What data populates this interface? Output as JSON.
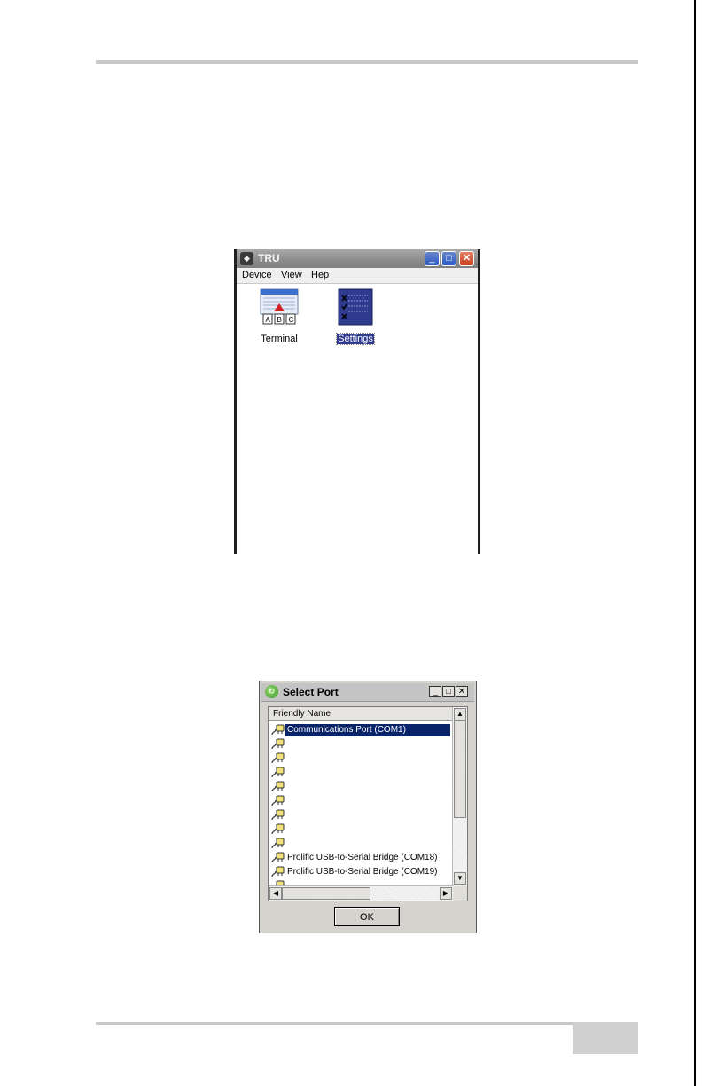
{
  "tru_window": {
    "title": "TRU",
    "menu": [
      "Device",
      "View",
      "Hep"
    ],
    "icons": [
      {
        "label": "Terminal",
        "icon": "terminal-icon",
        "selected": false
      },
      {
        "label": "Settings",
        "icon": "settings-icon",
        "selected": true
      }
    ],
    "controls": {
      "minimize": "_",
      "maximize": "□",
      "close": "✕"
    }
  },
  "select_port": {
    "title": "Select Port",
    "column_header": "Friendly Name",
    "ports": [
      {
        "label": "Communications Port (COM1)",
        "selected": true
      },
      {
        "label": "",
        "selected": false
      },
      {
        "label": "",
        "selected": false
      },
      {
        "label": "",
        "selected": false
      },
      {
        "label": "",
        "selected": false
      },
      {
        "label": "",
        "selected": false
      },
      {
        "label": "",
        "selected": false
      },
      {
        "label": "",
        "selected": false
      },
      {
        "label": "",
        "selected": false
      },
      {
        "label": "Prolific USB-to-Serial Bridge (COM18)",
        "selected": false
      },
      {
        "label": "Prolific USB-to-Serial Bridge (COM19)",
        "selected": false
      },
      {
        "label": "",
        "selected": false
      }
    ],
    "ok_label": "OK",
    "controls": {
      "minimize": "_",
      "maximize": "□",
      "close": "✕"
    }
  }
}
